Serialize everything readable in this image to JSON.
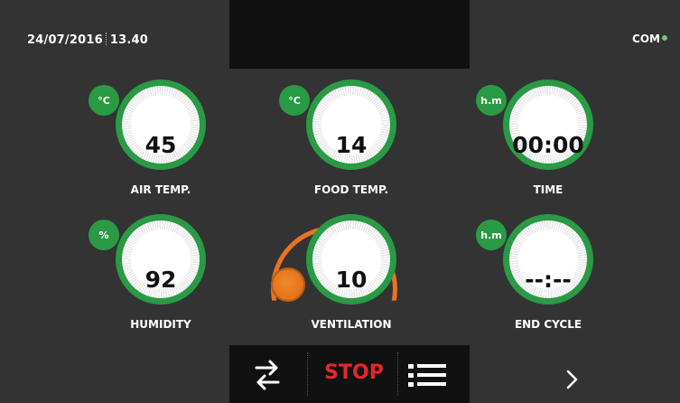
{
  "header": {
    "date": "24/07/2016",
    "time": "13.40",
    "com_label": "COM",
    "com_status_color": "#6ec96b"
  },
  "gauges": [
    {
      "id": "air-temp",
      "unit": "°C",
      "value": "45",
      "label": "AIR TEMP."
    },
    {
      "id": "food-temp",
      "unit": "°C",
      "value": "14",
      "label": "FOOD TEMP."
    },
    {
      "id": "time",
      "unit": "h.m",
      "value": "00:00",
      "label": "TIME"
    },
    {
      "id": "humidity",
      "unit": "%",
      "value": "92",
      "label": "HUMIDITY"
    },
    {
      "id": "ventilation",
      "unit": "",
      "value": "10",
      "label": "VENTILATION"
    },
    {
      "id": "end-cycle",
      "unit": "h.m",
      "value": "--:--",
      "label": "END CYCLE"
    }
  ],
  "controls": {
    "swap_icon": "swap-arrows-icon",
    "stop_label": "STOP",
    "menu_icon": "list-menu-icon",
    "next_icon": "chevron-right-icon"
  },
  "colors": {
    "gauge_green": "#2a9a45",
    "ventilation_orange": "#ea7322",
    "stop_red": "#e2282c",
    "background": "#333333",
    "panel_black": "#111111"
  }
}
